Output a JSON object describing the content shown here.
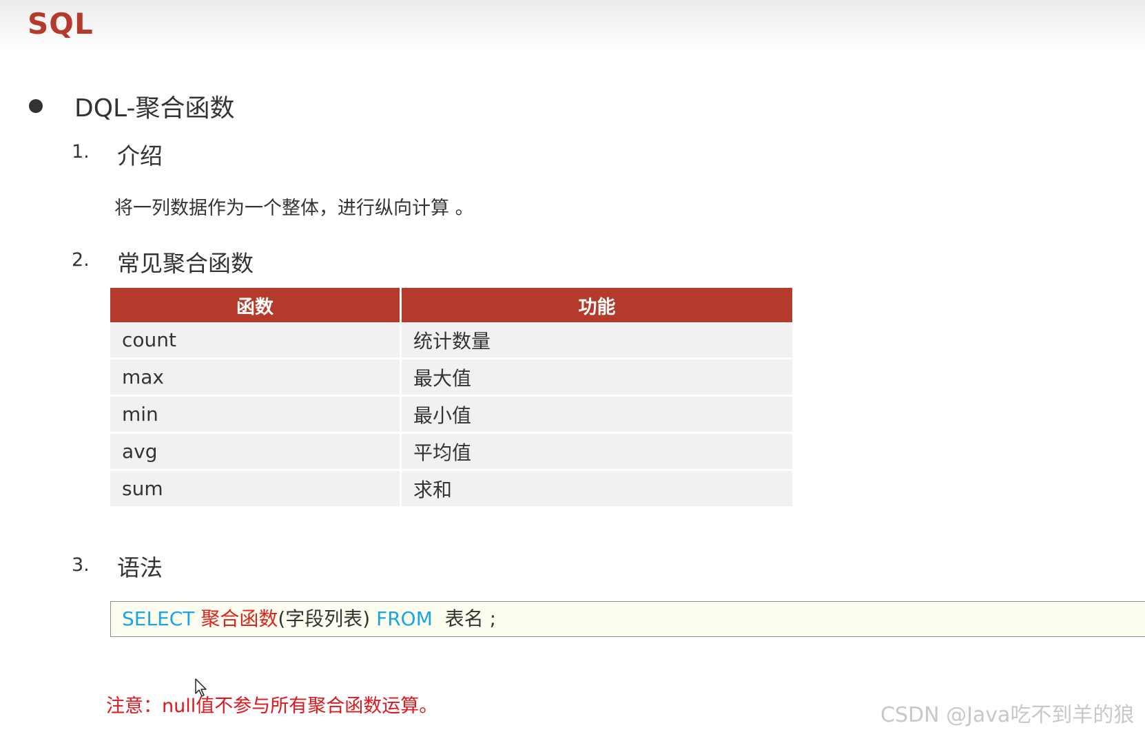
{
  "slide": {
    "title": "SQL",
    "section": "DQL-聚合函数"
  },
  "intro": {
    "number": "1.",
    "title": "介绍",
    "description": "将一列数据作为一个整体，进行纵向计算 。"
  },
  "common": {
    "number": "2.",
    "title": "常见聚合函数",
    "columns": [
      "函数",
      "功能"
    ],
    "rows": [
      {
        "func": "count",
        "desc": "统计数量"
      },
      {
        "func": "max",
        "desc": "最大值"
      },
      {
        "func": "min",
        "desc": "最小值"
      },
      {
        "func": "avg",
        "desc": "平均值"
      },
      {
        "func": "sum",
        "desc": "求和"
      }
    ]
  },
  "syntax": {
    "number": "3.",
    "title": "语法",
    "code": {
      "select": "SELECT",
      "func": "聚合函数",
      "fields": "(字段列表)",
      "from": "FROM",
      "table": "表名 ;"
    }
  },
  "note": "注意：null值不参与所有聚合函数运算。",
  "watermark": "CSDN @Java吃不到羊的狼",
  "colors": {
    "accent": "#b43a2b",
    "keyword": "#1aa3e8",
    "function": "#d9251d",
    "note": "#e0161d",
    "code_bg": "#fefef0"
  }
}
